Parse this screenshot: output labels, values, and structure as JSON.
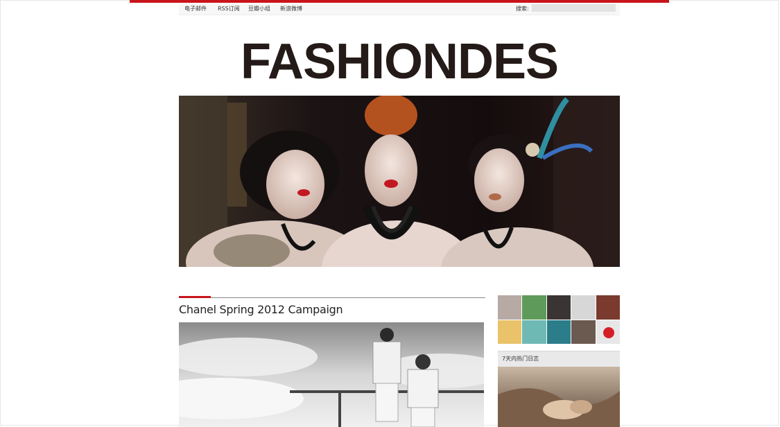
{
  "nav": {
    "items": [
      "电子邮件",
      "RSS订阅",
      "豆瓣小组",
      "新浪微博"
    ],
    "search_label": "搜索:",
    "search_value": ""
  },
  "site": {
    "logo_text": "FASHIONDES"
  },
  "post": {
    "title": "Chanel Spring 2012 Campaign"
  },
  "sidebar": {
    "popular_title": "7天内热门日志"
  },
  "colors": {
    "accent": "#c8141b",
    "logo": "#241a18"
  }
}
